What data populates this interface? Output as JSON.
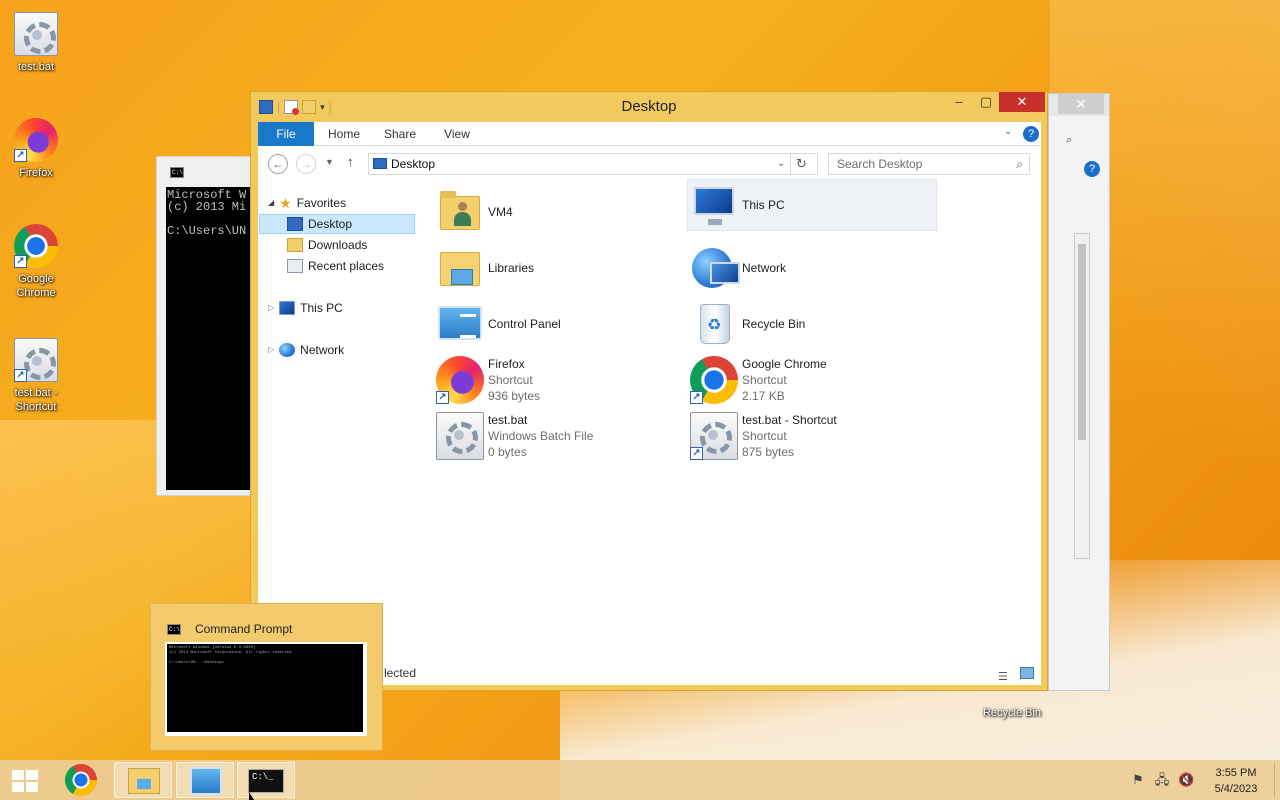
{
  "desktop": {
    "icons": [
      {
        "label": "test.bat",
        "icon": "batch-file-icon"
      },
      {
        "label": "Firefox",
        "icon": "firefox-icon"
      },
      {
        "label": "Google Chrome",
        "icon": "chrome-icon"
      },
      {
        "label": "test.bat - Shortcut",
        "icon": "batch-file-icon"
      },
      {
        "label": "Recycle Bin",
        "icon": "recycle-bin-icon"
      }
    ]
  },
  "cmd_window": {
    "lines": [
      "Microsoft W",
      "(c) 2013 Mi",
      "",
      "C:\\Users\\UN"
    ]
  },
  "explorer": {
    "title": "Desktop",
    "ribbon_tabs": [
      "File",
      "Home",
      "Share",
      "View"
    ],
    "address": "Desktop",
    "search_placeholder": "Search Desktop",
    "nav": {
      "favorites": "Favorites",
      "desktop": "Desktop",
      "downloads": "Downloads",
      "recent": "Recent places",
      "this_pc": "This PC",
      "network": "Network"
    },
    "items": [
      {
        "name": "VM4",
        "type": "",
        "size": ""
      },
      {
        "name": "This PC",
        "type": "",
        "size": ""
      },
      {
        "name": "Libraries",
        "type": "",
        "size": ""
      },
      {
        "name": "Network",
        "type": "",
        "size": ""
      },
      {
        "name": "Control Panel",
        "type": "",
        "size": ""
      },
      {
        "name": "Recycle Bin",
        "type": "",
        "size": ""
      },
      {
        "name": "Firefox",
        "type": "Shortcut",
        "size": "936 bytes"
      },
      {
        "name": "Google Chrome",
        "type": "Shortcut",
        "size": "2.17 KB"
      },
      {
        "name": "test.bat",
        "type": "Windows Batch File",
        "size": "0 bytes"
      },
      {
        "name": "test.bat - Shortcut",
        "type": "Shortcut",
        "size": "875 bytes"
      }
    ],
    "status_text": "lected"
  },
  "preview": {
    "title": "Command Prompt"
  },
  "taskbar": {
    "time": "3:55 PM",
    "date": "5/4/2023"
  },
  "colors": {
    "file_tab": "#1979ca",
    "close_button": "#c9302c",
    "selection": "#cce8ff"
  }
}
